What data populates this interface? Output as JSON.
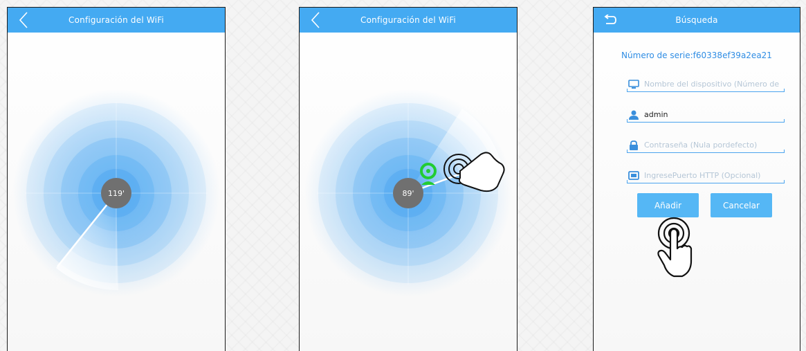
{
  "screen1": {
    "title": "Configuración del WiFi",
    "back_icon": "chevron-left-icon",
    "radar_angle": "119'"
  },
  "screen2": {
    "title": "Configuración del WiFi",
    "back_icon": "chevron-left-icon",
    "radar_angle": "89'",
    "found_device_icon": "camera-icon",
    "gesture_icon": "tap-hand-icon"
  },
  "screen3": {
    "title": "Búsqueda",
    "back_icon": "return-arrow-icon",
    "serial": "Número de serie:f60338ef39a2ea21",
    "fields": {
      "device_name": {
        "icon": "monitor-icon",
        "value": "",
        "placeholder": "Nombre del dispositivo (Número de"
      },
      "username": {
        "icon": "user-icon",
        "value": "admin",
        "placeholder": ""
      },
      "password": {
        "icon": "lock-icon",
        "value": "",
        "placeholder": "Contraseña (Nula pordefecto)"
      },
      "http_port": {
        "icon": "port-icon",
        "value": "",
        "placeholder": "IngresePuerto HTTP (Opcional)"
      }
    },
    "add_label": "Añadir",
    "cancel_label": "Cancelar",
    "gesture_icon": "tap-hand-icon"
  },
  "colors": {
    "header": "#44aaf2",
    "accent": "#2f8de4",
    "button": "#55b7f5",
    "device": "#22cc33",
    "radar_center": "#707070"
  }
}
